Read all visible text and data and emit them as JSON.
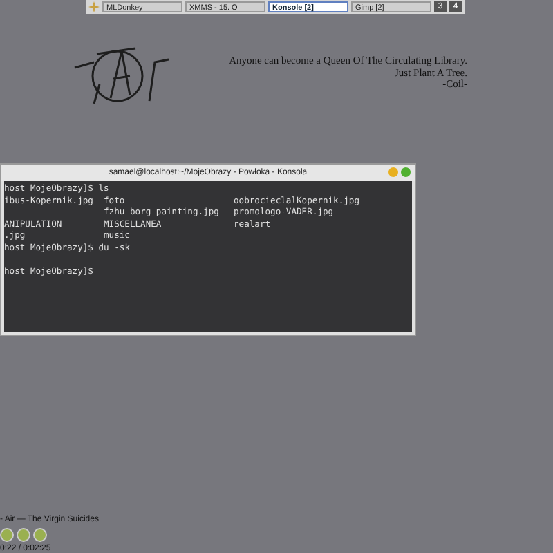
{
  "taskbar": {
    "tasks": [
      {
        "label": "MLDonkey",
        "selected": false
      },
      {
        "label": "XMMS - 15. O",
        "selected": false
      },
      {
        "label": "Konsole [2]",
        "selected": true
      },
      {
        "label": "Gimp [2]",
        "selected": false
      }
    ],
    "desktops": [
      {
        "label": "3",
        "selected": false
      },
      {
        "label": "4",
        "selected": false
      }
    ]
  },
  "quote": [
    "Anyone can become a Queen Of The Circulating Library.",
    "Just Plant A Tree.",
    "-Coil-"
  ],
  "konsole": {
    "title": "samael@localhost:~/MojeObrazy - Powłoka - Konsola",
    "lines": [
      {
        "kind": "text",
        "text": "host MojeObrazy]$ ls"
      },
      {
        "kind": "columns",
        "col_1": "ibus-Kopernik.jpg",
        "col_2": "foto",
        "col_3": "oobrocieclalKopernik.jpg"
      },
      {
        "kind": "columns",
        "col_2": "fzhu_borg_painting.jpg",
        "col_3": "promologo-VADER.jpg"
      },
      {
        "kind": "columns",
        "col_1": "ANIPULATION",
        "col_2": "MISCELLANEA",
        "col_3": "realart"
      },
      {
        "kind": "columns",
        "col_1": ".jpg",
        "col_2": "music"
      },
      {
        "kind": "text",
        "text": "host MojeObrazy]$ du -sk"
      },
      {
        "kind": "blank"
      },
      {
        "kind": "text",
        "text": "host MojeObrazy]$"
      }
    ]
  },
  "player": {
    "track": "- Air — The Virgin Suicides",
    "time": "0:22 / 0:02:25"
  }
}
